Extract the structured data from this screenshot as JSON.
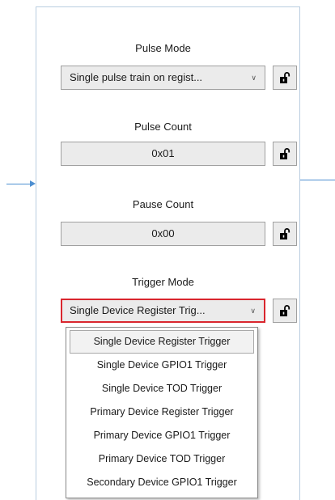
{
  "pulse_mode": {
    "label": "Pulse Mode",
    "value": "Single pulse train on regist...",
    "lock_icon": "unlock-icon"
  },
  "pulse_count": {
    "label": "Pulse Count",
    "value": "0x01",
    "lock_icon": "unlock-icon"
  },
  "pause_count": {
    "label": "Pause Count",
    "value": "0x00",
    "lock_icon": "unlock-icon"
  },
  "trigger_mode": {
    "label": "Trigger Mode",
    "value": "Single Device Register Trig...",
    "lock_icon": "unlock-icon",
    "options": [
      "Single Device Register Trigger",
      "Single Device GPIO1 Trigger",
      "Single Device TOD Trigger",
      "Primary Device Register Trigger",
      "Primary Device GPIO1 Trigger",
      "Primary Device TOD Trigger",
      "Secondary Device GPIO1 Trigger"
    ],
    "selected_option": "Single Device Register Trigger"
  },
  "colors": {
    "wire": "#4d8fd1",
    "panel_border": "#b9cde0",
    "field_bg": "#ebebeb",
    "active_border": "#d9262e"
  }
}
